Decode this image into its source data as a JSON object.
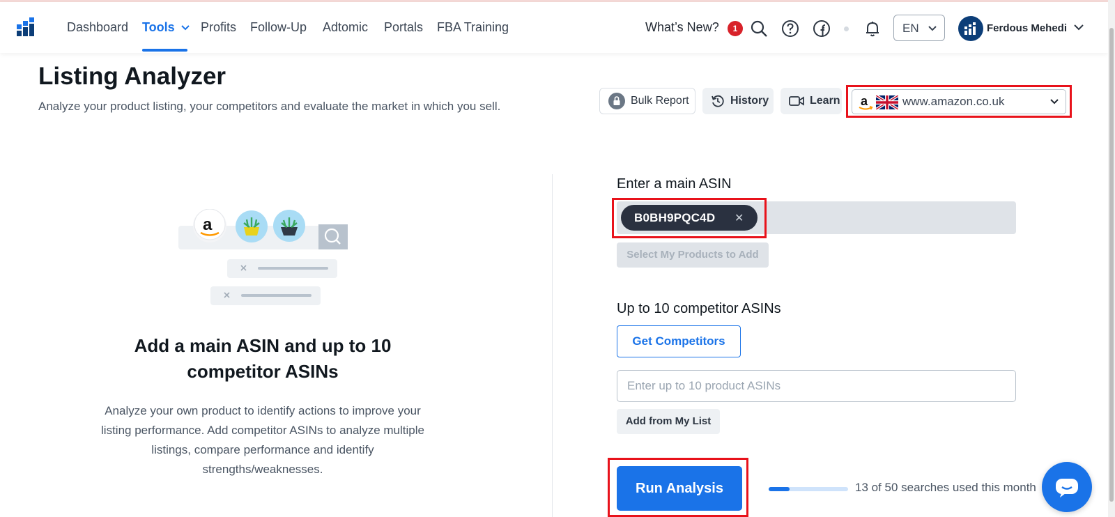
{
  "nav": {
    "links": [
      {
        "label": "Dashboard"
      },
      {
        "label": "Tools"
      },
      {
        "label": "Profits"
      },
      {
        "label": "Follow-Up"
      },
      {
        "label": "Adtomic"
      },
      {
        "label": "Portals"
      },
      {
        "label": "FBA Training"
      }
    ],
    "whats_new": "What’s New?",
    "whats_new_count": "1",
    "language": "EN",
    "user_name": "Ferdous Mehedi"
  },
  "header": {
    "title": "Listing Analyzer",
    "subtitle": "Analyze your product listing, your competitors and evaluate the market in which you sell.",
    "bulk_report": "Bulk Report",
    "history": "History",
    "learn": "Learn",
    "marketplace": "www.amazon.co.uk"
  },
  "left": {
    "heading": "Add a main ASIN and up to 10 competitor ASINs",
    "description": "Analyze your own product to identify actions to improve your listing performance. Add competitor ASINs to analyze multiple listings, compare performance and identify strengths/weaknesses."
  },
  "form": {
    "main_asin_label": "Enter a main ASIN",
    "main_asin_value": "B0BH9PQC4D",
    "select_products": "Select My Products to Add",
    "competitor_label": "Up to 10 competitor ASINs",
    "get_competitors": "Get Competitors",
    "competitor_placeholder": "Enter up to 10 product ASINs",
    "add_from_list": "Add from My List",
    "run_analysis": "Run Analysis",
    "searches_used": 13,
    "searches_total": 50,
    "searches_text": "13 of 50 searches used this month"
  },
  "colors": {
    "accent": "#1a73e8",
    "highlight": "#e8121b",
    "badge": "#d8222a"
  }
}
